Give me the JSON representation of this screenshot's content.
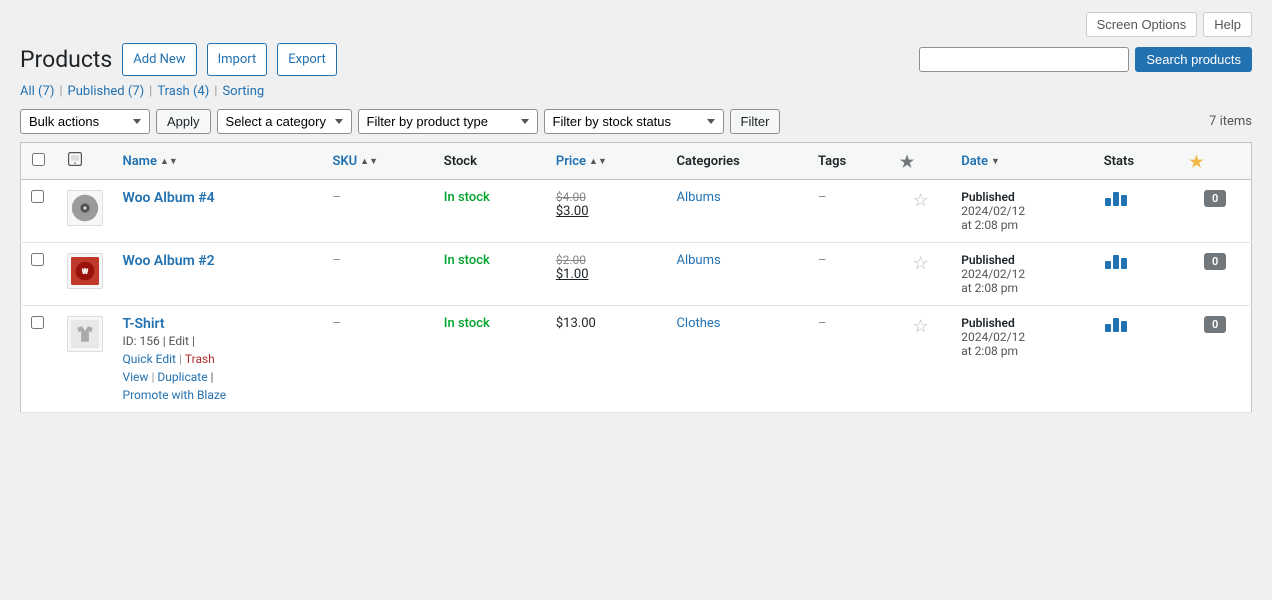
{
  "header": {
    "title": "Products",
    "buttons": {
      "add_new": "Add New",
      "import": "Import",
      "export": "Export",
      "screen_options": "Screen Options",
      "help": "Help"
    }
  },
  "subsubsub": {
    "all": "All",
    "all_count": "7",
    "published": "Published",
    "published_count": "7",
    "trash": "Trash",
    "trash_count": "4",
    "sorting": "Sorting"
  },
  "search": {
    "placeholder": "",
    "button_label": "Search products"
  },
  "filters": {
    "bulk_actions_label": "Bulk actions",
    "apply_label": "Apply",
    "category_placeholder": "Select a category",
    "product_type_placeholder": "Filter by product type",
    "stock_status_placeholder": "Filter by stock status",
    "filter_label": "Filter",
    "items_count": "7 items"
  },
  "table": {
    "columns": {
      "checkbox": "",
      "thumb": "",
      "name": "Name",
      "sku": "SKU",
      "stock": "Stock",
      "price": "Price",
      "categories": "Categories",
      "tags": "Tags",
      "featured": "★",
      "date": "Date",
      "stats": "Stats",
      "badge": "★"
    },
    "rows": [
      {
        "id": "1",
        "thumb_color": "#9b9b9b",
        "thumb_type": "album",
        "name": "Woo Album #4",
        "sku": "–",
        "stock": "In stock",
        "price_original": "$4.00",
        "price_sale": "$3.00",
        "categories": "Albums",
        "tags": "–",
        "date_status": "Published",
        "date_value": "2024/02/12",
        "date_time": "at 2:08 pm",
        "stats_bars": [
          3,
          5,
          4
        ],
        "badge": "0",
        "row_actions": null
      },
      {
        "id": "2",
        "thumb_color": "#c0392b",
        "thumb_type": "album2",
        "name": "Woo Album #2",
        "sku": "–",
        "stock": "In stock",
        "price_original": "$2.00",
        "price_sale": "$1.00",
        "categories": "Albums",
        "tags": "–",
        "date_status": "Published",
        "date_value": "2024/02/12",
        "date_time": "at 2:08 pm",
        "stats_bars": [
          3,
          5,
          4
        ],
        "badge": "0",
        "row_actions": null
      },
      {
        "id": "156",
        "thumb_color": "#aaa",
        "thumb_type": "tshirt",
        "name": "T-Shirt",
        "sku": "–",
        "stock": "In stock",
        "price_regular": "$13.00",
        "categories": "Clothes",
        "tags": "–",
        "date_status": "Published",
        "date_value": "2024/02/12",
        "date_time": "at 2:08 pm",
        "stats_bars": [
          3,
          5,
          4
        ],
        "badge": "0",
        "row_actions": {
          "id_label": "ID: 156",
          "edit": "Edit",
          "quick_edit": "Quick Edit",
          "trash": "Trash",
          "view": "View",
          "duplicate": "Duplicate",
          "promote": "Promote with Blaze"
        }
      }
    ]
  }
}
